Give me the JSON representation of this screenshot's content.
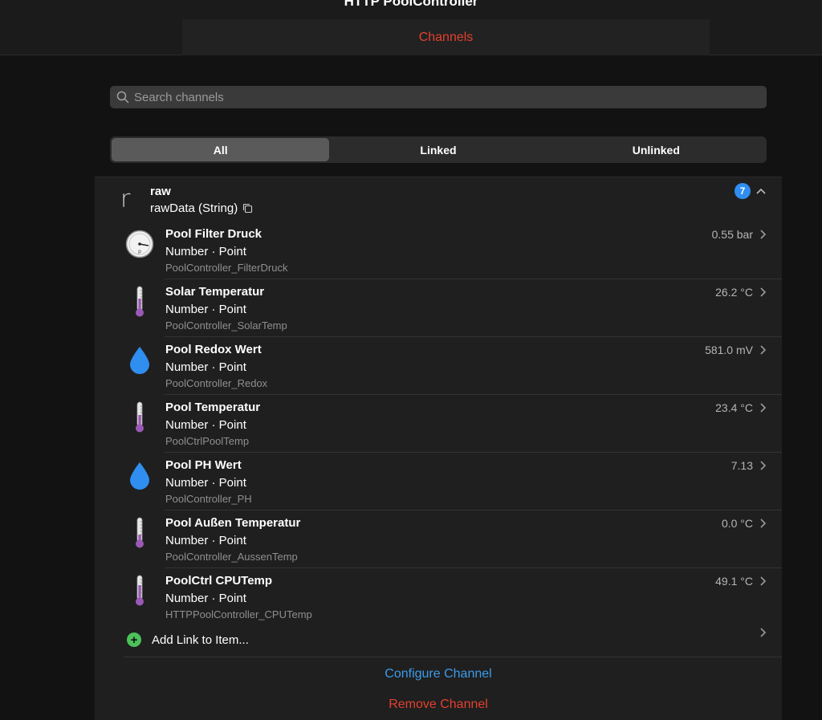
{
  "app": {
    "title": "HTTP PoolController"
  },
  "tabs": {
    "active_label": "Channels"
  },
  "search": {
    "placeholder": "Search channels"
  },
  "filter": {
    "options": [
      "All",
      "Linked",
      "Unlinked"
    ],
    "selected": "All"
  },
  "channel": {
    "letter": "r",
    "name": "raw",
    "subtitle": "rawData (String)",
    "link_count": "7"
  },
  "items": [
    {
      "label": "Pool Filter Druck",
      "type": "Number · Point",
      "name": "PoolController_FilterDruck",
      "state": "0.55 bar",
      "icon": "pressure-gauge-icon"
    },
    {
      "label": "Solar Temperatur",
      "type": "Number · Point",
      "name": "PoolController_SolarTemp",
      "state": "26.2 °C",
      "icon": "thermometer-icon"
    },
    {
      "label": "Pool Redox Wert",
      "type": "Number · Point",
      "name": "PoolController_Redox",
      "state": "581.0 mV",
      "icon": "water-drop-icon"
    },
    {
      "label": "Pool Temperatur",
      "type": "Number · Point",
      "name": "PoolCtrlPoolTemp",
      "state": "23.4 °C",
      "icon": "thermometer-icon"
    },
    {
      "label": "Pool PH Wert",
      "type": "Number · Point",
      "name": "PoolController_PH",
      "state": "7.13",
      "icon": "water-drop-icon"
    },
    {
      "label": "Pool Außen Temperatur",
      "type": "Number · Point",
      "name": "PoolController_AussenTemp",
      "state": "0.0 °C",
      "icon": "thermometer-icon"
    },
    {
      "label": "PoolCtrl CPUTemp",
      "type": "Number · Point",
      "name": "HTTPPoolController_CPUTemp",
      "state": "49.1 °C",
      "icon": "thermometer-icon"
    }
  ],
  "add_link": {
    "label": "Add Link to Item..."
  },
  "actions": {
    "configure": "Configure Channel",
    "remove": "Remove Channel"
  },
  "colors": {
    "accent_red": "#e2402e",
    "link_blue": "#3d9be9",
    "badge_blue": "#2f8ef0",
    "add_green": "#4bc25a",
    "thermo_purple": "#9b59b6",
    "drop_blue": "#2f8ef0"
  }
}
